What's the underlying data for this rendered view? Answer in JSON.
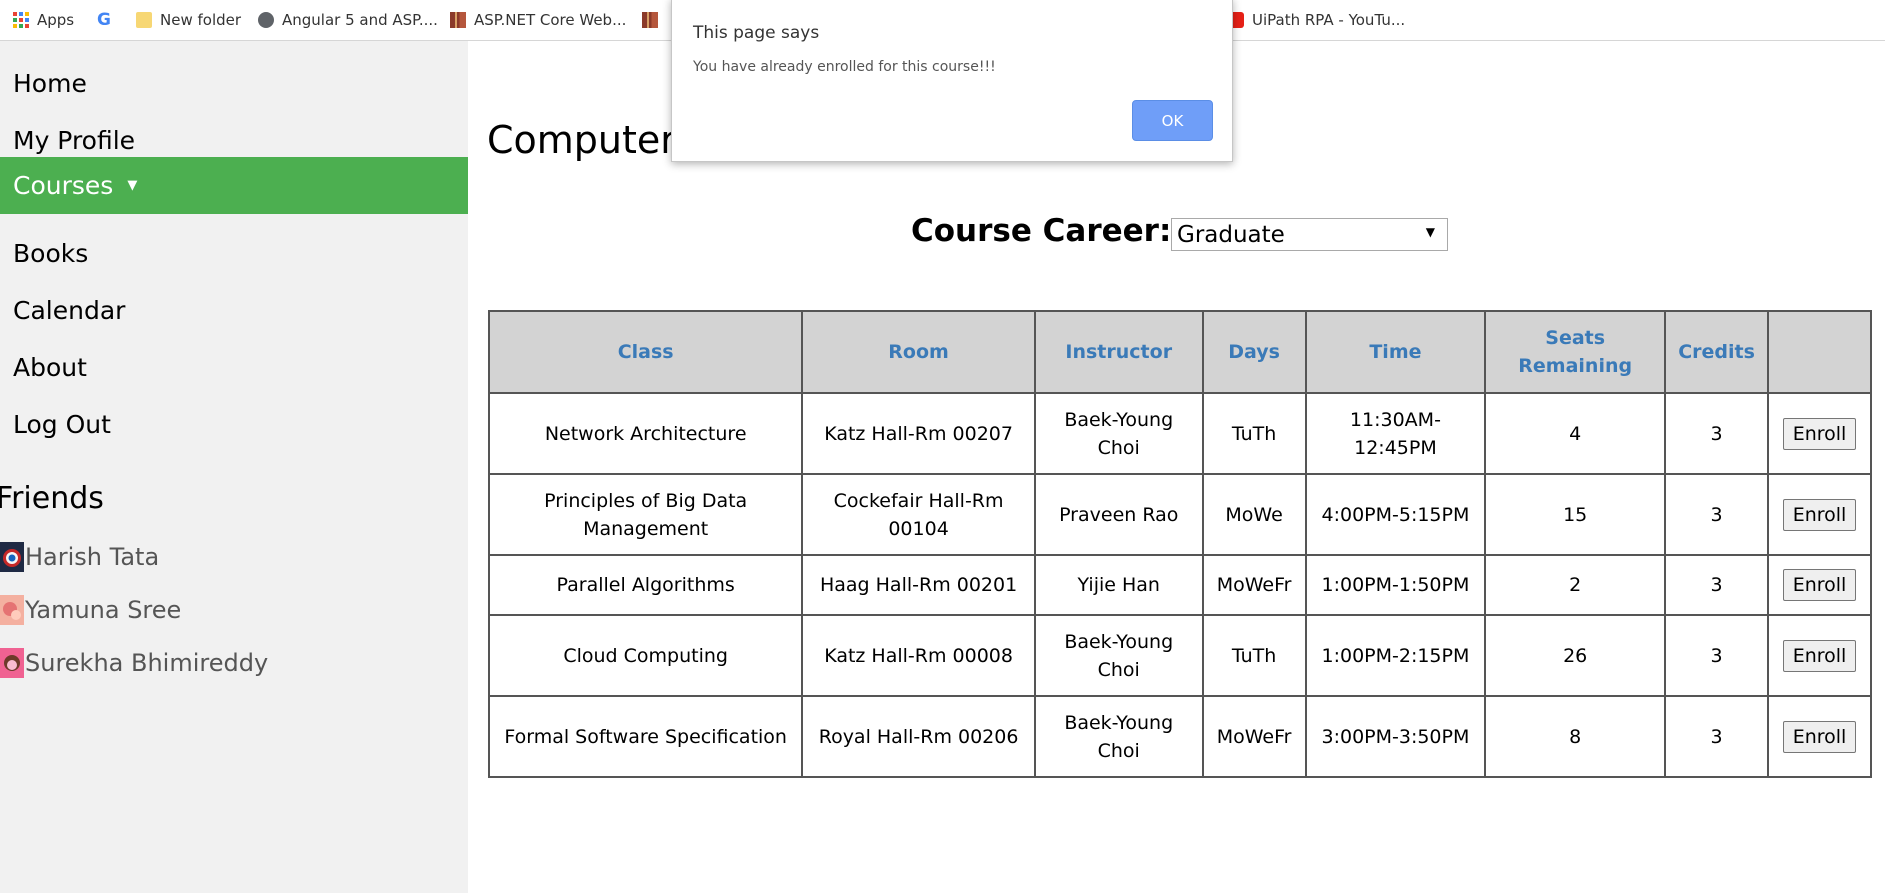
{
  "bookmarks": [
    {
      "label": "Apps",
      "icon": "apps-grid-icon"
    },
    {
      "label": "",
      "icon": "google-icon"
    },
    {
      "label": "New folder",
      "icon": "folder-icon"
    },
    {
      "label": "Angular 5 and ASP....",
      "icon": "globe-icon"
    },
    {
      "label": "ASP.NET Core Web...",
      "icon": "chart-icon"
    },
    {
      "label": "",
      "icon": "chart-icon"
    },
    {
      "label": "UiPath RPA - YouTu...",
      "icon": "youtube-icon"
    }
  ],
  "sidebar": {
    "items": [
      {
        "label": "Home"
      },
      {
        "label": "My Profile"
      },
      {
        "label": "Courses",
        "caret": "▼"
      },
      {
        "label": "Books"
      },
      {
        "label": "Calendar"
      },
      {
        "label": "About"
      },
      {
        "label": "Log Out"
      }
    ],
    "friends_title": "Friends",
    "friends": [
      {
        "name": "Harish Tata"
      },
      {
        "name": "Yamuna Sree"
      },
      {
        "name": "Surekha Bhimireddy"
      }
    ]
  },
  "main": {
    "title": "Computer S",
    "career_label": "Course Career:",
    "career_selected": "Graduate",
    "table": {
      "headers": [
        "Class",
        "Room",
        "Instructor",
        "Days",
        "Time",
        "Seats Remaining",
        "Credits",
        ""
      ],
      "rows": [
        {
          "class": "Network Architecture",
          "room": "Katz Hall-Rm 00207",
          "instructor": "Baek-Young Choi",
          "days": "TuTh",
          "time": "11:30AM-12:45PM",
          "seats": "4",
          "credits": "3",
          "action": "Enroll"
        },
        {
          "class": "Principles of Big Data Management",
          "room": "Cockefair Hall-Rm 00104",
          "instructor": "Praveen Rao",
          "days": "MoWe",
          "time": "4:00PM-5:15PM",
          "seats": "15",
          "credits": "3",
          "action": "Enroll"
        },
        {
          "class": "Parallel Algorithms",
          "room": "Haag Hall-Rm 00201",
          "instructor": "Yijie Han",
          "days": "MoWeFr",
          "time": "1:00PM-1:50PM",
          "seats": "2",
          "credits": "3",
          "action": "Enroll"
        },
        {
          "class": "Cloud Computing",
          "room": "Katz Hall-Rm 00008",
          "instructor": "Baek-Young Choi",
          "days": "TuTh",
          "time": "1:00PM-2:15PM",
          "seats": "26",
          "credits": "3",
          "action": "Enroll"
        },
        {
          "class": "Formal Software Specification",
          "room": "Royal Hall-Rm 00206",
          "instructor": "Baek-Young Choi",
          "days": "MoWeFr",
          "time": "3:00PM-3:50PM",
          "seats": "8",
          "credits": "3",
          "action": "Enroll"
        }
      ]
    }
  },
  "dialog": {
    "title": "This page says",
    "message": "You have already enrolled for this course!!!",
    "ok_label": "OK"
  },
  "colors": {
    "active_nav": "#4caf50",
    "header_text": "#3a7ab8",
    "ok_button": "#6f9ef8"
  }
}
